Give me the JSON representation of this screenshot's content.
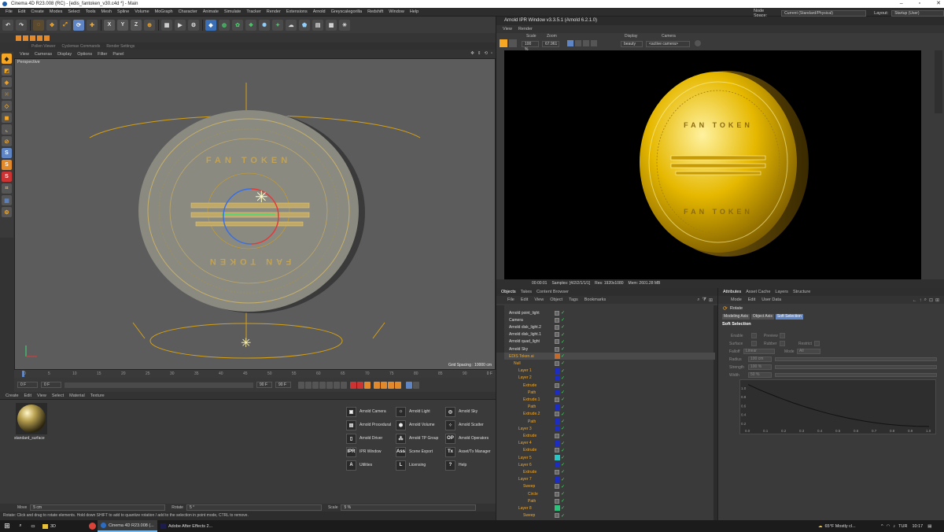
{
  "window": {
    "title": "Cinema 4D R23.008 (RC) - [edis_fantoken_v30.c4d *] - Main"
  },
  "menubar": {
    "items": [
      "File",
      "Edit",
      "Create",
      "Modes",
      "Select",
      "Tools",
      "Mesh",
      "Spline",
      "Volume",
      "MoGraph",
      "Character",
      "Animate",
      "Simulate",
      "Tracker",
      "Render",
      "Extensions",
      "Arnold",
      "Greyscalegorilla",
      "Redshift",
      "Window",
      "Help"
    ],
    "node_space_label": "Node Space:",
    "node_space_value": "Current (Standard/Physical)",
    "layout_label": "Layout:",
    "layout_value": "Startup (User)"
  },
  "toolbar": {
    "axis": [
      "X",
      "Y",
      "Z"
    ]
  },
  "secondbar": {
    "items": [
      "Pollen Viewer",
      "Cyclemax Commands",
      "Render Settings"
    ]
  },
  "viewport": {
    "menu": [
      "View",
      "Cameras",
      "Display",
      "Options",
      "Filter",
      "Panel"
    ],
    "label": "Perspective",
    "grid_spacing": "Grid Spacing : 10000 cm"
  },
  "timeline": {
    "ticks": [
      "0",
      "5",
      "10",
      "15",
      "20",
      "25",
      "30",
      "35",
      "40",
      "45",
      "50",
      "55",
      "60",
      "65",
      "70",
      "75",
      "80",
      "85",
      "90"
    ],
    "end": "0 F"
  },
  "transport": {
    "current": "0 F",
    "min": "0 F",
    "max": "90 F",
    "max2": "90 F"
  },
  "material": {
    "menu": [
      "Create",
      "Edit",
      "View",
      "Select",
      "Material",
      "Texture"
    ],
    "swatch_label": "standard_surface"
  },
  "arnold_buttons": [
    {
      "label": "Arnold Camera",
      "icon": "camera-icon",
      "glyph": "▣"
    },
    {
      "label": "Arnold Light",
      "icon": "bulb-icon",
      "glyph": "☼"
    },
    {
      "label": "Arnold Sky",
      "icon": "sky-icon",
      "glyph": "◎"
    },
    {
      "label": "Arnold Procedural",
      "icon": "procedural-icon",
      "glyph": "▤"
    },
    {
      "label": "Arnold Volume",
      "icon": "volume-icon",
      "glyph": "⬢"
    },
    {
      "label": "Arnold Scatter",
      "icon": "scatter-icon",
      "glyph": "⁘"
    },
    {
      "label": "Arnold Driver",
      "icon": "driver-icon",
      "glyph": "▯"
    },
    {
      "label": "Arnold TP Group",
      "icon": "tp-group-icon",
      "glyph": "⁂"
    },
    {
      "label": "Arnold Operators",
      "icon": "operators-icon",
      "glyph": "OP"
    },
    {
      "label": "IPR Window",
      "icon": "ipr-icon",
      "glyph": "IPR"
    },
    {
      "label": "Scene Export",
      "icon": "ass-icon",
      "glyph": "Ass"
    },
    {
      "label": "Asset/Tx Manager",
      "icon": "tx-icon",
      "glyph": "Tx"
    },
    {
      "label": "Utilities",
      "icon": "utilities-icon",
      "glyph": "A"
    },
    {
      "label": "Licensing",
      "icon": "licensing-icon",
      "glyph": "L"
    },
    {
      "label": "Help",
      "icon": "help-icon",
      "glyph": "?"
    }
  ],
  "coords": {
    "move_label": "Move",
    "move_val": "5 cm",
    "rotate_label": "Rotate",
    "rotate_val": "5 °",
    "scale_label": "Scale",
    "scale_val": "5 %"
  },
  "status": {
    "text": "Rotate: Click and drag to rotate elements. Hold down SHIFT to add to quantize rotation / add to the selection in point mode, CTRL to remove."
  },
  "ipr": {
    "title": "Arnold IPR Window v3.3.5.1 (Arnold 6.2.1.0)",
    "menu": [
      "View",
      "Render"
    ],
    "scale_label": "Scale",
    "scale_val": "100 %",
    "zoom_label": "Zoom",
    "zoom_val": "67.961",
    "display_label": "Display",
    "display_val": "beauty",
    "camera_label": "Camera",
    "camera_val": "<active camera>",
    "status_time": "00:00:01",
    "status_samples": "Samples: [4/2/2/1/1/1]",
    "status_res": "Res: 1920x1080",
    "status_mem": "Mem: 2601.28 MB"
  },
  "objects": {
    "tabs": [
      "Objects",
      "Takes",
      "Content Browser"
    ],
    "menu": [
      "File",
      "Edit",
      "View",
      "Object",
      "Tags",
      "Bookmarks"
    ],
    "rows": [
      {
        "name": "Arnold point_light",
        "color": "#ddd"
      },
      {
        "name": "Camera",
        "color": "#ddd"
      },
      {
        "name": "Arnold disk_light.2",
        "color": "#ddd"
      },
      {
        "name": "Arnold disk_light.1",
        "color": "#ddd"
      },
      {
        "name": "Arnold quad_light",
        "color": "#ddd"
      },
      {
        "name": "Arnold Sky",
        "color": "#ddd"
      },
      {
        "name": "EDIS Token.ai",
        "color": "#f5a623"
      },
      {
        "name": "Null",
        "color": "#f5a623"
      },
      {
        "name": "Layer 1",
        "color": "#f5a623"
      },
      {
        "name": "Layer 2",
        "color": "#f5a623"
      },
      {
        "name": "Extrude",
        "color": "#f5a623"
      },
      {
        "name": "Path",
        "color": "#f5a623"
      },
      {
        "name": "Extrude.1",
        "color": "#f5a623"
      },
      {
        "name": "Path",
        "color": "#f5a623"
      },
      {
        "name": "Extrude.2",
        "color": "#f5a623"
      },
      {
        "name": "Path",
        "color": "#f5a623"
      },
      {
        "name": "Layer 3",
        "color": "#f5a623"
      },
      {
        "name": "Extrude",
        "color": "#f5a623"
      },
      {
        "name": "Layer 4",
        "color": "#f5a623"
      },
      {
        "name": "Extrude",
        "color": "#f5a623"
      },
      {
        "name": "Layer 5",
        "color": "#f5a623"
      },
      {
        "name": "Layer 6",
        "color": "#f5a623"
      },
      {
        "name": "Extrude",
        "color": "#f5a623"
      },
      {
        "name": "Layer 7",
        "color": "#f5a623"
      },
      {
        "name": "Sweep",
        "color": "#f5a623"
      },
      {
        "name": "Circle",
        "color": "#f5a623"
      },
      {
        "name": "Path",
        "color": "#f5a623"
      },
      {
        "name": "Layer 8",
        "color": "#f5a623"
      },
      {
        "name": "Sweep",
        "color": "#f5a623"
      },
      {
        "name": "Circle",
        "color": "#f5a623"
      }
    ]
  },
  "attributes": {
    "tabs": [
      "Attributes",
      "Asset Cache",
      "Layers",
      "Structure"
    ],
    "menu": [
      "Mode",
      "Edit",
      "User Data"
    ],
    "object": "Rotate",
    "mode_tabs": [
      "Modeling Axis",
      "Object Axis",
      "Soft Selection"
    ],
    "section": "Soft Selection",
    "fields": {
      "enable": "Enable",
      "preview": "Preview",
      "surface": "Surface",
      "rubber": "Rubber",
      "restrict": "Restrict",
      "falloff": "Falloff",
      "falloff_val": "Linear",
      "mode": "Mode",
      "mode_val": "All",
      "radius": "Radius",
      "radius_val": "100 cm",
      "strength": "Strength",
      "strength_val": "100 %",
      "width": "Width",
      "width_val": "50 %"
    },
    "graph_x": [
      "0.0",
      "0.1",
      "0.2",
      "0.3",
      "0.4",
      "0.5",
      "0.6",
      "0.7",
      "0.8",
      "0.9",
      "1.0"
    ],
    "graph_y": [
      "1.0",
      "0.8",
      "0.6",
      "0.4",
      "0.2"
    ]
  },
  "taskbar": {
    "items": [
      "3D",
      "Cinema 4D R23.008 (...",
      "Adobe After Effects 2..."
    ],
    "weather": "65°F  Mostly cl...",
    "lang": "TUR",
    "time": "10:17"
  },
  "colors": {
    "accent": "#5f85c4",
    "gold": "#e6b800",
    "check": "#4cd46a"
  }
}
